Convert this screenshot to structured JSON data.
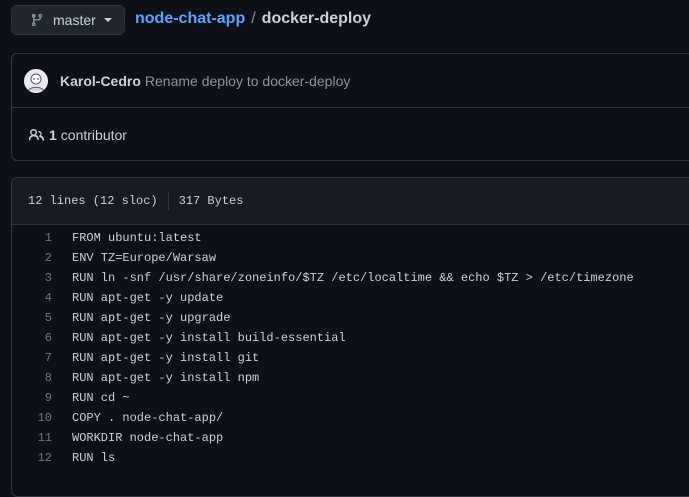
{
  "branch": {
    "label": "master"
  },
  "breadcrumb": {
    "repo": "node-chat-app",
    "separator": "/",
    "file": "docker-deploy"
  },
  "commit": {
    "author": "Karol-Cedro",
    "message": "Rename deploy to docker-deploy"
  },
  "contributors": {
    "count": "1",
    "label": "contributor"
  },
  "file_info": {
    "lines": "12 lines (12 sloc)",
    "size": "317 Bytes"
  },
  "code_lines": [
    {
      "num": "1",
      "text": "FROM ubuntu:latest"
    },
    {
      "num": "2",
      "text": "ENV TZ=Europe/Warsaw"
    },
    {
      "num": "3",
      "text": "RUN ln -snf /usr/share/zoneinfo/$TZ /etc/localtime && echo $TZ > /etc/timezone"
    },
    {
      "num": "4",
      "text": "RUN apt-get -y update"
    },
    {
      "num": "5",
      "text": "RUN apt-get -y upgrade"
    },
    {
      "num": "6",
      "text": "RUN apt-get -y install build-essential"
    },
    {
      "num": "7",
      "text": "RUN apt-get -y install git"
    },
    {
      "num": "8",
      "text": "RUN apt-get -y install npm"
    },
    {
      "num": "9",
      "text": "RUN cd ~"
    },
    {
      "num": "10",
      "text": "COPY . node-chat-app/"
    },
    {
      "num": "11",
      "text": "WORKDIR node-chat-app"
    },
    {
      "num": "12",
      "text": "RUN ls"
    }
  ],
  "icons": {
    "branch": "git-branch-icon",
    "caret": "caret-down-icon",
    "people": "people-icon",
    "avatar": "avatar"
  },
  "colors": {
    "background": "#0d1117",
    "link": "#58a6ff",
    "border": "#30363d",
    "header_bg": "#161b22"
  }
}
